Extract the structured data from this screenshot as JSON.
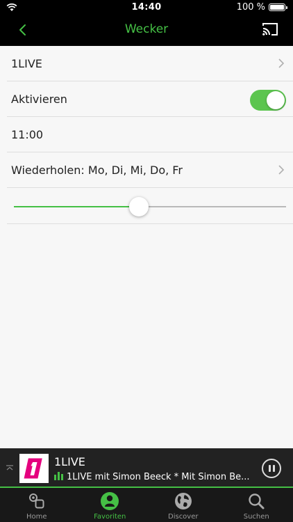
{
  "status_bar": {
    "time": "14:40",
    "battery_percent": "100 %"
  },
  "nav": {
    "title": "Wecker",
    "back_icon": "chevron-left-icon",
    "cast_icon": "cast-icon"
  },
  "alarm": {
    "station": "1LIVE",
    "activate_label": "Aktivieren",
    "activated": true,
    "time": "11:00",
    "repeat_label": "Wiederholen: Mo, Di, Mi, Do, Fr",
    "volume_fraction": 0.46
  },
  "player": {
    "station": "1LIVE",
    "now_playing": "1LIVE mit Simon Beeck * Mit Simon Be...",
    "logo_text": "1",
    "state": "playing"
  },
  "tabs": [
    {
      "label": "Home",
      "icon": "home-icon",
      "active": false
    },
    {
      "label": "Favoriten",
      "icon": "favorites-icon",
      "active": true
    },
    {
      "label": "Discover",
      "icon": "globe-icon",
      "active": false
    },
    {
      "label": "Suchen",
      "icon": "search-icon",
      "active": false
    }
  ],
  "colors": {
    "accent": "#45c045",
    "toggle_on": "#5cc54f",
    "logo_pink": "#e5007e",
    "bar_bg": "#000000"
  }
}
